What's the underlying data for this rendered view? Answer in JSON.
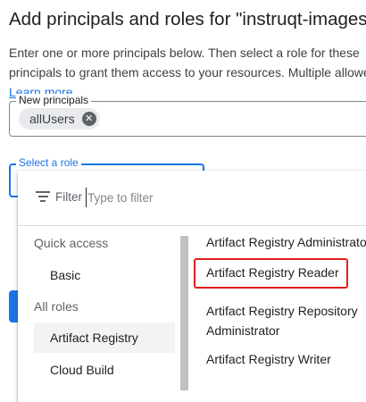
{
  "header": {
    "title": "Add principals and roles for \"instruqt-images\"",
    "description": "Enter one or more principals below. Then select a role for these principals to grant them access to your resources. Multiple allowed.",
    "learn_more": "Learn more"
  },
  "principals": {
    "label": "New principals",
    "chips": [
      {
        "label": "allUsers"
      }
    ]
  },
  "role_select": {
    "label": "Select a role"
  },
  "dropdown": {
    "filter_label": "Filter",
    "filter_placeholder": "Type to filter",
    "quick_access": "Quick access",
    "basic": "Basic",
    "all_roles": "All roles",
    "categories": [
      {
        "label": "Artifact Registry",
        "selected": true
      },
      {
        "label": "Cloud Build",
        "selected": false
      }
    ],
    "roles": [
      {
        "label": "Artifact Registry Administrator"
      },
      {
        "label": "Artifact Registry Reader",
        "highlighted": true
      },
      {
        "label": "Artifact Registry Repository Administrator"
      },
      {
        "label": "Artifact Registry Writer"
      }
    ]
  },
  "colors": {
    "accent": "#1a73e8",
    "highlight": "#e0201e",
    "selected_bg": "#f1f3f4"
  }
}
